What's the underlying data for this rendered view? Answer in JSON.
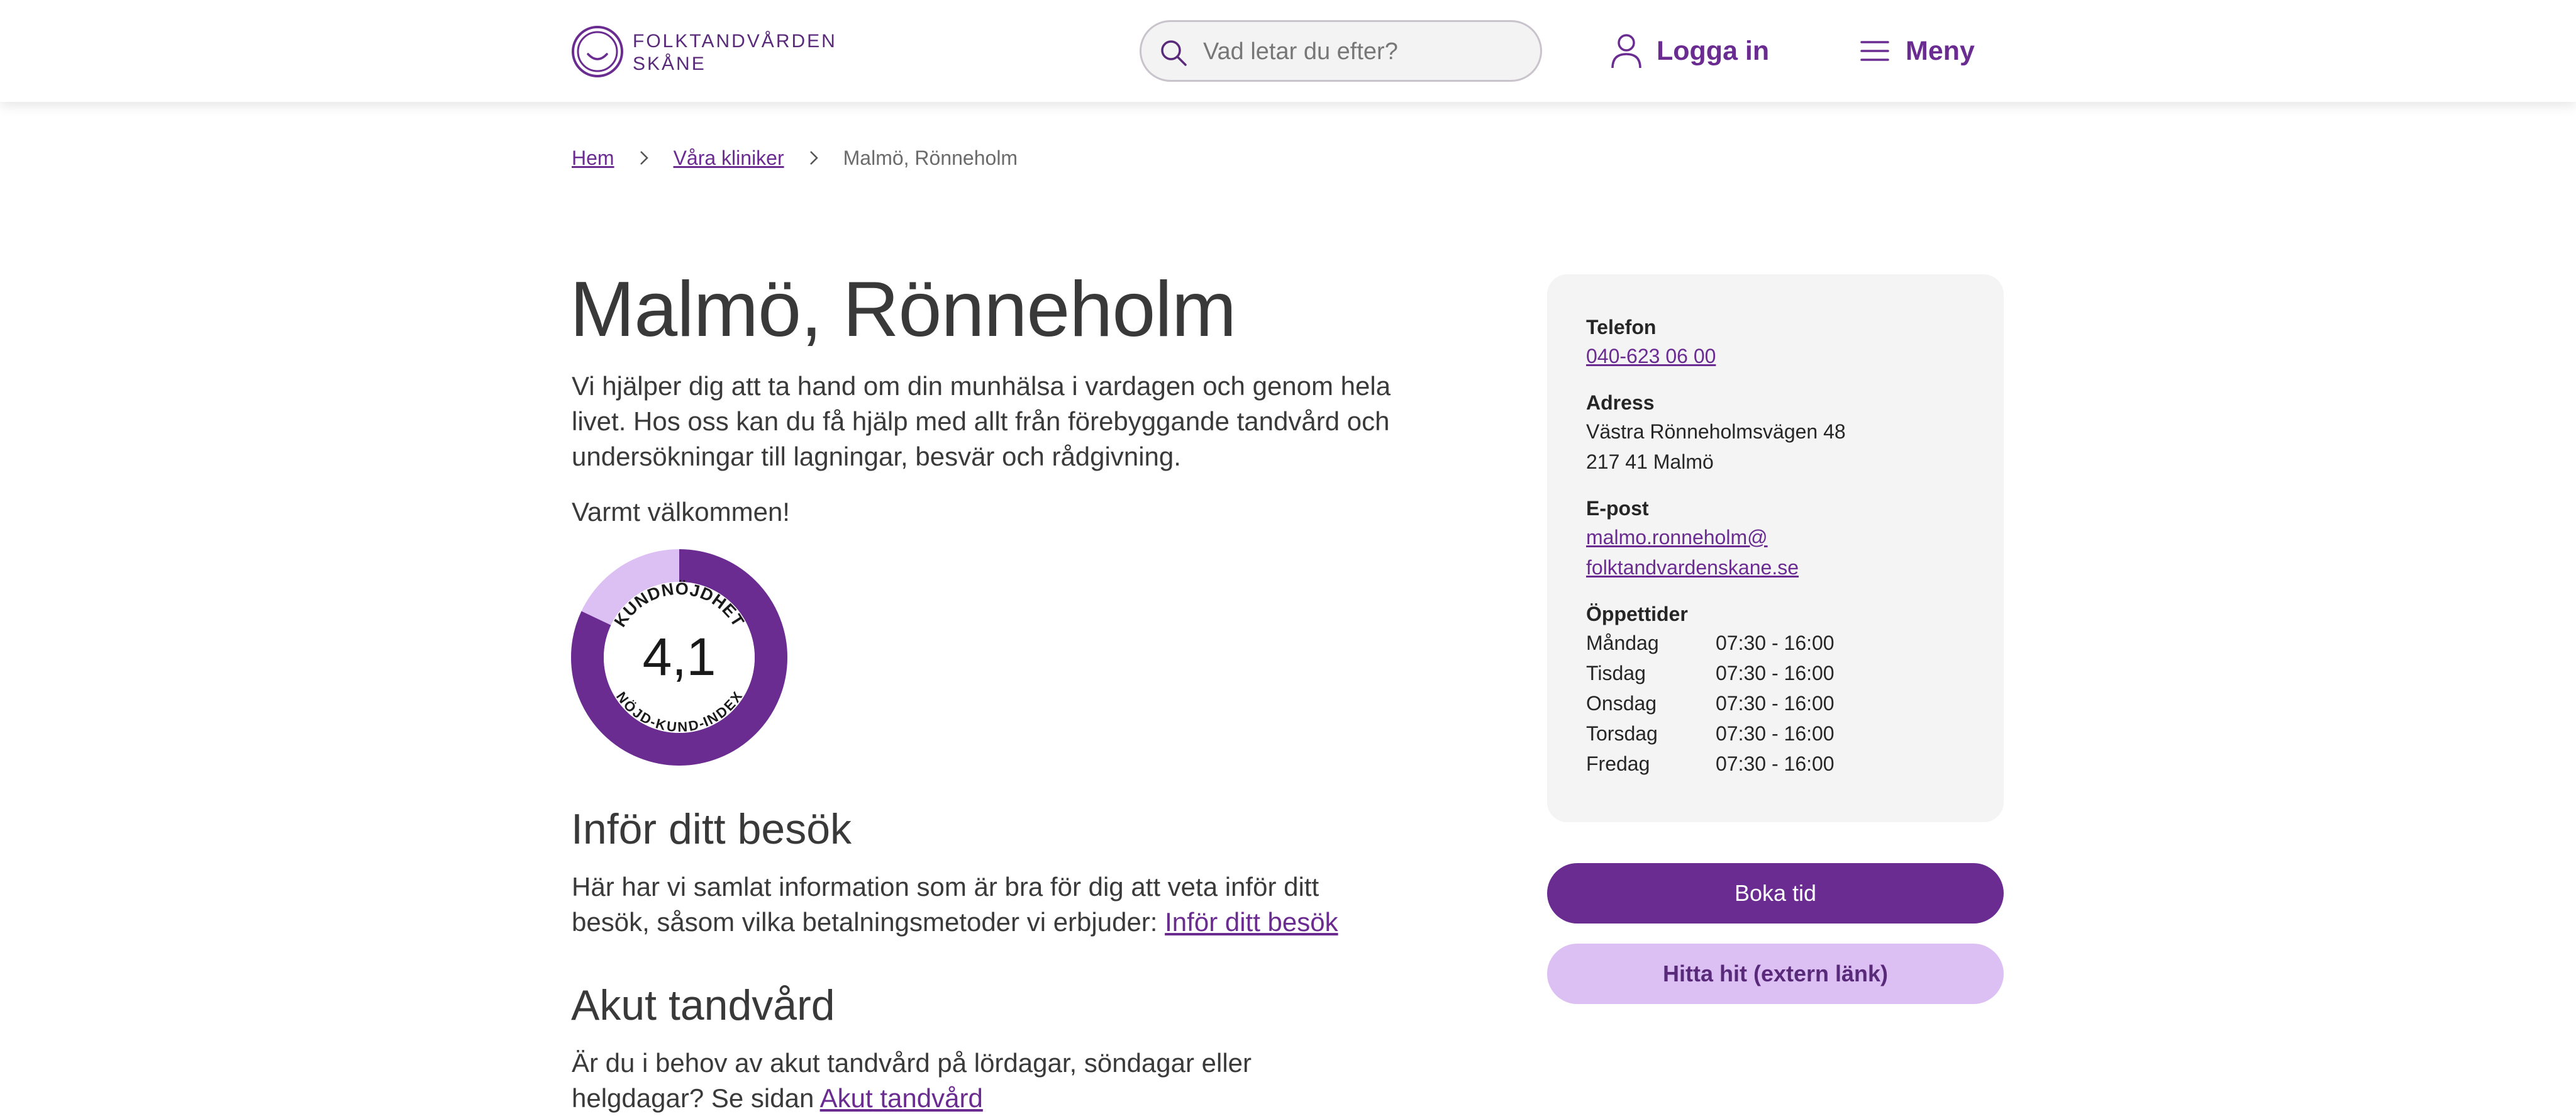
{
  "header": {
    "logo_line1": "FOLKTANDVÅRDEN",
    "logo_line2": "SKÅNE",
    "search_placeholder": "Vad letar du efter?",
    "login_label": "Logga in",
    "menu_label": "Meny"
  },
  "breadcrumb": {
    "home": "Hem",
    "clinics": "Våra kliniker",
    "current": "Malmö, Rönneholm"
  },
  "main": {
    "title": "Malmö, Rönneholm",
    "intro": "Vi hjälper dig att ta hand om din munhälsa i vardagen och genom hela livet. Hos oss kan du få hjälp med allt från förebyggande tandvård och undersökningar till lagningar, besvär och rådgivning.",
    "welcome": "Varmt välkommen!",
    "satisfaction": {
      "top_label": "KUNDNÖJDHET",
      "bottom_label": "NÖJD-KUND-INDEX",
      "score": "4,1",
      "fill_fraction": 0.82
    },
    "visit": {
      "heading": "Inför ditt besök",
      "text": "Här har vi samlat information som är bra för dig att veta inför ditt besök, såsom vilka betalningsmetoder vi erbjuder: ",
      "link": "Inför ditt besök"
    },
    "acute": {
      "heading": "Akut tandvård",
      "text": "Är du i behov av akut tandvård på lördagar, söndagar eller helgdagar? Se sidan ",
      "link": "Akut tandvård"
    }
  },
  "contact": {
    "phone_label": "Telefon",
    "phone": "040-623 06 00",
    "address_label": "Adress",
    "address_line1": "Västra Rönneholmsvägen 48",
    "address_line2": "217 41 Malmö",
    "email_label": "E-post",
    "email_line1": "malmo.ronneholm@",
    "email_line2": "folktandvardenskane.se",
    "hours_label": "Öppettider",
    "hours": [
      {
        "day": "Måndag",
        "time": "07:30 - 16:00"
      },
      {
        "day": "Tisdag",
        "time": "07:30 - 16:00"
      },
      {
        "day": "Onsdag",
        "time": "07:30 - 16:00"
      },
      {
        "day": "Torsdag",
        "time": "07:30 - 16:00"
      },
      {
        "day": "Fredag",
        "time": "07:30 - 16:00"
      }
    ]
  },
  "actions": {
    "book": "Boka tid",
    "directions": "Hitta hit (extern länk)"
  },
  "colors": {
    "brand_purple": "#6b2c91",
    "light_purple": "#dcc0f4",
    "text_dark": "#333333",
    "card_bg": "#f4f4f4"
  },
  "icons": {
    "logo": "smile-circle-icon",
    "search": "search-icon",
    "login": "user-icon",
    "menu": "hamburger-menu-icon",
    "breadcrumb_separator": "chevron-right-icon"
  }
}
